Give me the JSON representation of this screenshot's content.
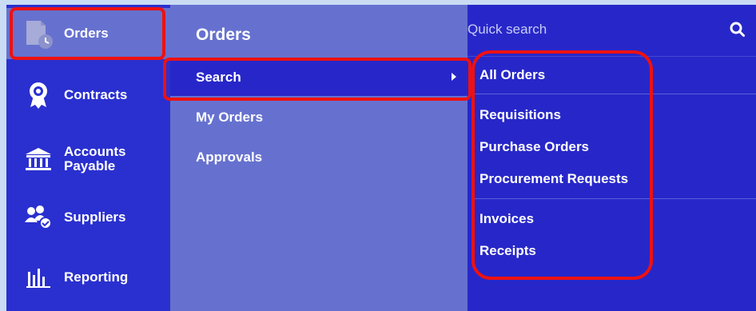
{
  "nav": {
    "items": [
      {
        "label": "Orders",
        "icon": "orders-clock-icon"
      },
      {
        "label": "Contracts",
        "icon": "award-ribbon-icon"
      },
      {
        "label": "Accounts Payable",
        "icon": "bank-icon"
      },
      {
        "label": "Suppliers",
        "icon": "suppliers-group-icon"
      },
      {
        "label": "Reporting",
        "icon": "bar-chart-icon"
      }
    ]
  },
  "submenu": {
    "title": "Orders",
    "items": [
      {
        "label": "Search"
      },
      {
        "label": "My Orders"
      },
      {
        "label": "Approvals"
      }
    ]
  },
  "search": {
    "placeholder": "Quick search",
    "results": [
      {
        "label": "All Orders"
      },
      {
        "label": "Requisitions"
      },
      {
        "label": "Purchase Orders"
      },
      {
        "label": "Procurement Requests"
      },
      {
        "label": "Invoices"
      },
      {
        "label": "Receipts"
      }
    ]
  },
  "colors": {
    "nav_bg": "#2a30cf",
    "submenu_bg": "#6671cf",
    "search_bg": "#2727c9",
    "highlight": "#ee1111"
  }
}
